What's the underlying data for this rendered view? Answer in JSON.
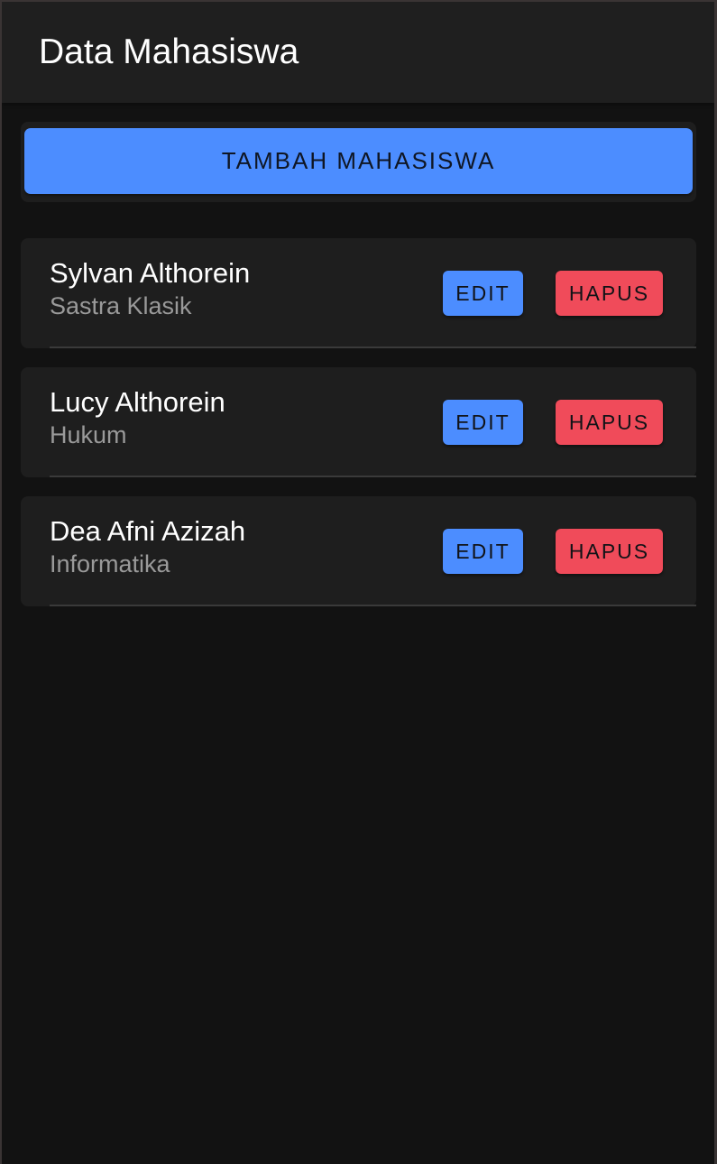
{
  "header": {
    "title": "Data Mahasiswa"
  },
  "actions": {
    "add_label": "TAMBAH MAHASISWA"
  },
  "students": [
    {
      "name": "Sylvan Althorein",
      "major": "Sastra Klasik",
      "edit_label": "EDIT",
      "delete_label": "HAPUS"
    },
    {
      "name": "Lucy Althorein",
      "major": "Hukum",
      "edit_label": "EDIT",
      "delete_label": "HAPUS"
    },
    {
      "name": "Dea Afni Azizah",
      "major": "Informatika",
      "edit_label": "EDIT",
      "delete_label": "HAPUS"
    }
  ],
  "colors": {
    "background": "#121212",
    "toolbar": "#1f1f1f",
    "card": "#1e1e1e",
    "primary": "#4c8dff",
    "danger": "#f04b5a",
    "text_primary": "#ffffff",
    "text_secondary": "#9a9a9a"
  }
}
